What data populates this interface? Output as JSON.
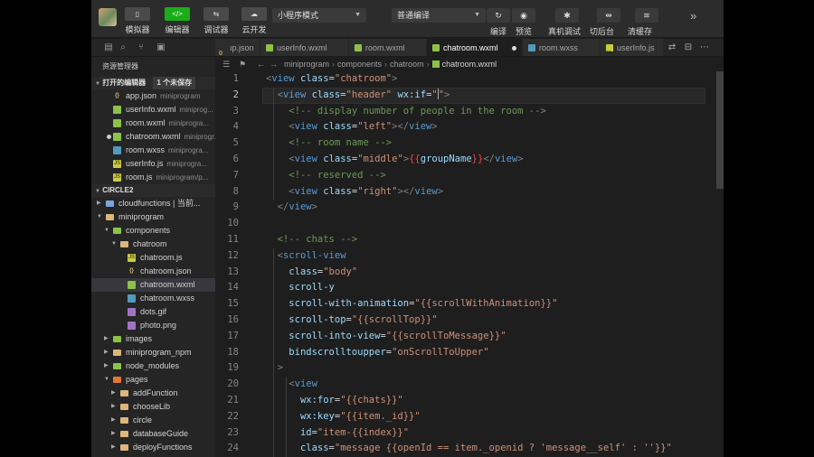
{
  "toolbar": {
    "left_buttons": [
      {
        "icon": "phone-icon",
        "glyph": "▯",
        "label": "模拟器"
      },
      {
        "icon": "code-icon",
        "glyph": "</>",
        "label": "编辑器"
      },
      {
        "icon": "debugger-icon",
        "glyph": "⇆",
        "label": "调试器"
      },
      {
        "icon": "cloud-icon",
        "glyph": "☁",
        "label": "云开发"
      }
    ],
    "mode_select": "小程序模式",
    "compile_select": "普通编译",
    "right_buttons": [
      {
        "icon": "refresh-icon",
        "glyph": "↻",
        "label": "编译"
      },
      {
        "icon": "eye-icon",
        "glyph": "◉",
        "label": "预览"
      },
      {
        "icon": "bug-icon",
        "glyph": "✱",
        "label": "真机调试"
      },
      {
        "icon": "switch-icon",
        "glyph": "⇹",
        "label": "切后台"
      },
      {
        "icon": "layers-icon",
        "glyph": "≋",
        "label": "清缓存"
      }
    ],
    "more_glyph": "»"
  },
  "sidebar": {
    "title": "资源管理器",
    "open_editors": {
      "label": "打开的编辑器",
      "badge": "1 个未保存"
    },
    "open_files": [
      {
        "name": "app.json",
        "desc": "miniprogram",
        "type": "json",
        "modified": false
      },
      {
        "name": "userInfo.wxml",
        "desc": "miniprog...",
        "type": "wxml",
        "modified": false
      },
      {
        "name": "room.wxml",
        "desc": "miniprogra...",
        "type": "wxml",
        "modified": false
      },
      {
        "name": "chatroom.wxml",
        "desc": "miniprogr...",
        "type": "wxml",
        "modified": true
      },
      {
        "name": "room.wxss",
        "desc": "miniprogra...",
        "type": "wxss",
        "modified": false
      },
      {
        "name": "userInfo.js",
        "desc": "miniprogra...",
        "type": "js",
        "modified": false
      },
      {
        "name": "room.js",
        "desc": "miniprogram/p...",
        "type": "js",
        "modified": false
      }
    ],
    "project": "CIRCLE2",
    "tree": [
      {
        "name": "cloudfunctions | 当前...",
        "type": "folder-blue",
        "depth": 1,
        "open": false
      },
      {
        "name": "miniprogram",
        "type": "folder",
        "depth": 1,
        "open": true
      },
      {
        "name": "components",
        "type": "folder-green",
        "depth": 2,
        "open": true
      },
      {
        "name": "chatroom",
        "type": "folder",
        "depth": 3,
        "open": true
      },
      {
        "name": "chatroom.js",
        "type": "js",
        "depth": 4
      },
      {
        "name": "chatroom.json",
        "type": "json",
        "depth": 4
      },
      {
        "name": "chatroom.wxml",
        "type": "wxml",
        "depth": 4,
        "selected": true
      },
      {
        "name": "chatroom.wxss",
        "type": "wxss",
        "depth": 4
      },
      {
        "name": "dots.gif",
        "type": "img",
        "depth": 4
      },
      {
        "name": "photo.png",
        "type": "img",
        "depth": 4
      },
      {
        "name": "images",
        "type": "folder-green",
        "depth": 2,
        "open": false
      },
      {
        "name": "miniprogram_npm",
        "type": "folder",
        "depth": 2,
        "open": false
      },
      {
        "name": "node_modules",
        "type": "folder-green",
        "depth": 2,
        "open": false
      },
      {
        "name": "pages",
        "type": "folder-red",
        "depth": 2,
        "open": true
      },
      {
        "name": "addFunction",
        "type": "folder",
        "depth": 3,
        "open": false
      },
      {
        "name": "chooseLib",
        "type": "folder",
        "depth": 3,
        "open": false
      },
      {
        "name": "circle",
        "type": "folder",
        "depth": 3,
        "open": false
      },
      {
        "name": "databaseGuide",
        "type": "folder",
        "depth": 3,
        "open": false
      },
      {
        "name": "deployFunctions",
        "type": "folder",
        "depth": 3,
        "open": false
      }
    ]
  },
  "editor": {
    "tabs": [
      {
        "name": "ıp.json",
        "type": "json",
        "active": false,
        "modified": false
      },
      {
        "name": "userInfo.wxml",
        "type": "wxml",
        "active": false,
        "modified": false
      },
      {
        "name": "room.wxml",
        "type": "wxml",
        "active": false,
        "modified": false
      },
      {
        "name": "chatroom.wxml",
        "type": "wxml",
        "active": true,
        "modified": true
      },
      {
        "name": "room.wxss",
        "type": "wxss",
        "active": false,
        "modified": false
      },
      {
        "name": "userInfo.js",
        "type": "js",
        "active": false,
        "modified": false
      }
    ],
    "breadcrumb": [
      "miniprogram",
      "components",
      "chatroom",
      "chatroom.wxml"
    ],
    "current_line": 2,
    "lines": [
      [
        {
          "t": "<",
          "c": "punc"
        },
        {
          "t": "view",
          "c": "tag"
        },
        {
          "t": " "
        },
        {
          "t": "class",
          "c": "attr"
        },
        {
          "t": "="
        },
        {
          "t": "\"chatroom\"",
          "c": "str"
        },
        {
          "t": ">",
          "c": "punc"
        }
      ],
      [
        {
          "t": "  "
        },
        {
          "t": "<",
          "c": "punc"
        },
        {
          "t": "view",
          "c": "tag"
        },
        {
          "t": " "
        },
        {
          "t": "class",
          "c": "attr"
        },
        {
          "t": "="
        },
        {
          "t": "\"header\"",
          "c": "str"
        },
        {
          "t": " "
        },
        {
          "t": "wx:if",
          "c": "attr"
        },
        {
          "t": "="
        },
        {
          "t": "\"",
          "c": "str"
        },
        {
          "t": "",
          "c": "cursor"
        },
        {
          "t": "\"",
          "c": "str"
        },
        {
          "t": ">",
          "c": "punc"
        }
      ],
      [
        {
          "t": "    "
        },
        {
          "t": "<!-- display number of people in the room -->",
          "c": "cmt"
        }
      ],
      [
        {
          "t": "    "
        },
        {
          "t": "<",
          "c": "punc"
        },
        {
          "t": "view",
          "c": "tag"
        },
        {
          "t": " "
        },
        {
          "t": "class",
          "c": "attr"
        },
        {
          "t": "="
        },
        {
          "t": "\"left\"",
          "c": "str"
        },
        {
          "t": "></",
          "c": "punc"
        },
        {
          "t": "view",
          "c": "tag"
        },
        {
          "t": ">",
          "c": "punc"
        }
      ],
      [
        {
          "t": "    "
        },
        {
          "t": "<!-- room name -->",
          "c": "cmt"
        }
      ],
      [
        {
          "t": "    "
        },
        {
          "t": "<",
          "c": "punc"
        },
        {
          "t": "view",
          "c": "tag"
        },
        {
          "t": " "
        },
        {
          "t": "class",
          "c": "attr"
        },
        {
          "t": "="
        },
        {
          "t": "\"middle\"",
          "c": "str"
        },
        {
          "t": ">",
          "c": "punc"
        },
        {
          "t": "{{",
          "c": "exp"
        },
        {
          "t": "groupName",
          "c": "var"
        },
        {
          "t": "}}",
          "c": "exp"
        },
        {
          "t": "</",
          "c": "punc"
        },
        {
          "t": "view",
          "c": "tag"
        },
        {
          "t": ">",
          "c": "punc"
        }
      ],
      [
        {
          "t": "    "
        },
        {
          "t": "<!-- reserved -->",
          "c": "cmt"
        }
      ],
      [
        {
          "t": "    "
        },
        {
          "t": "<",
          "c": "punc"
        },
        {
          "t": "view",
          "c": "tag"
        },
        {
          "t": " "
        },
        {
          "t": "class",
          "c": "attr"
        },
        {
          "t": "="
        },
        {
          "t": "\"right\"",
          "c": "str"
        },
        {
          "t": "></",
          "c": "punc"
        },
        {
          "t": "view",
          "c": "tag"
        },
        {
          "t": ">",
          "c": "punc"
        }
      ],
      [
        {
          "t": "  "
        },
        {
          "t": "</",
          "c": "punc"
        },
        {
          "t": "view",
          "c": "tag"
        },
        {
          "t": ">",
          "c": "punc"
        }
      ],
      [
        {
          "t": ""
        }
      ],
      [
        {
          "t": "  "
        },
        {
          "t": "<!-- chats -->",
          "c": "cmt"
        }
      ],
      [
        {
          "t": "  "
        },
        {
          "t": "<",
          "c": "punc"
        },
        {
          "t": "scroll-view",
          "c": "tag"
        }
      ],
      [
        {
          "t": "    "
        },
        {
          "t": "class",
          "c": "attr"
        },
        {
          "t": "="
        },
        {
          "t": "\"body\"",
          "c": "str"
        }
      ],
      [
        {
          "t": "    "
        },
        {
          "t": "scroll-y",
          "c": "attr"
        }
      ],
      [
        {
          "t": "    "
        },
        {
          "t": "scroll-with-animation",
          "c": "attr"
        },
        {
          "t": "="
        },
        {
          "t": "\"{{scrollWithAnimation}}\"",
          "c": "str"
        }
      ],
      [
        {
          "t": "    "
        },
        {
          "t": "scroll-top",
          "c": "attr"
        },
        {
          "t": "="
        },
        {
          "t": "\"{{scrollTop}}\"",
          "c": "str"
        }
      ],
      [
        {
          "t": "    "
        },
        {
          "t": "scroll-into-view",
          "c": "attr"
        },
        {
          "t": "="
        },
        {
          "t": "\"{{scrollToMessage}}\"",
          "c": "str"
        }
      ],
      [
        {
          "t": "    "
        },
        {
          "t": "bindscrolltoupper",
          "c": "attr"
        },
        {
          "t": "="
        },
        {
          "t": "\"onScrollToUpper\"",
          "c": "str"
        }
      ],
      [
        {
          "t": "  "
        },
        {
          "t": ">",
          "c": "punc"
        }
      ],
      [
        {
          "t": "    "
        },
        {
          "t": "<",
          "c": "punc"
        },
        {
          "t": "view",
          "c": "tag"
        }
      ],
      [
        {
          "t": "      "
        },
        {
          "t": "wx:for",
          "c": "attr"
        },
        {
          "t": "="
        },
        {
          "t": "\"{{chats}}\"",
          "c": "str"
        }
      ],
      [
        {
          "t": "      "
        },
        {
          "t": "wx:key",
          "c": "attr"
        },
        {
          "t": "="
        },
        {
          "t": "\"{{item._id}}\"",
          "c": "str"
        }
      ],
      [
        {
          "t": "      "
        },
        {
          "t": "id",
          "c": "attr"
        },
        {
          "t": "="
        },
        {
          "t": "\"item-{{index}}\"",
          "c": "str"
        }
      ],
      [
        {
          "t": "      "
        },
        {
          "t": "class",
          "c": "attr"
        },
        {
          "t": "="
        },
        {
          "t": "\"message {{openId == item._openid ? 'message__self' : ''}}\"",
          "c": "str"
        }
      ]
    ]
  }
}
